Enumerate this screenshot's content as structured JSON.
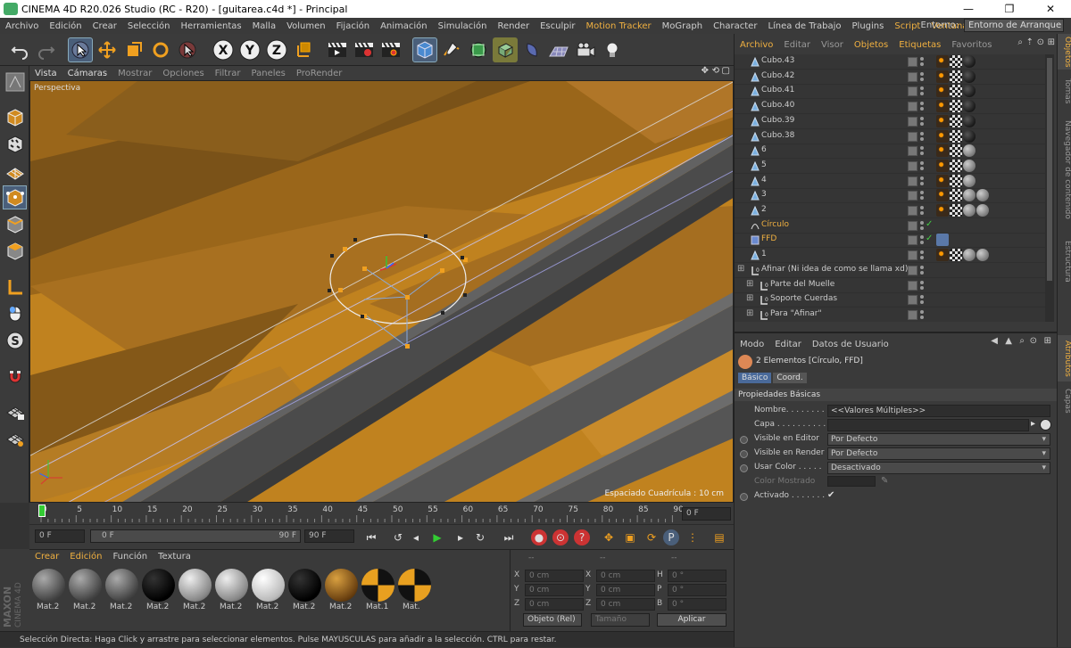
{
  "titlebar": {
    "title": "CINEMA 4D R20.026 Studio (RC - R20) - [guitarea.c4d *] - Principal",
    "minimize": "—",
    "maximize": "❐",
    "close": "✕"
  },
  "menubar": {
    "items": [
      "Archivo",
      "Edición",
      "Crear",
      "Selección",
      "Herramientas",
      "Malla",
      "Volumen",
      "Fijación",
      "Animación",
      "Simulación",
      "Render",
      "Esculpir",
      "Motion Tracker",
      "MoGraph",
      "Character",
      "Línea de Trabajo",
      "Plugins",
      "Script",
      "Ventana",
      "Ayuda"
    ],
    "highlighted": [
      "Motion Tracker",
      "Script",
      "Ventana"
    ],
    "env_label": "Entorno:",
    "env_value": "Entorno de Arranque"
  },
  "viewport": {
    "menu": [
      "Vista",
      "Cámaras",
      "Mostrar",
      "Opciones",
      "Filtrar",
      "Paneles",
      "ProRender"
    ],
    "label": "Perspectiva",
    "grid_text": "Espaciado Cuadrícula : 10 cm"
  },
  "timeline": {
    "ticks": [
      "0",
      "5",
      "10",
      "15",
      "20",
      "25",
      "30",
      "35",
      "40",
      "45",
      "50",
      "55",
      "60",
      "65",
      "70",
      "75",
      "80",
      "85",
      "90"
    ],
    "frame_display": "0 F"
  },
  "transport": {
    "start": "0 F",
    "range_start": "0 F",
    "range_end": "90 F",
    "end": "90 F"
  },
  "materials": {
    "menu": [
      "Crear",
      "Edición",
      "Función",
      "Textura"
    ],
    "items": [
      {
        "name": "Mat.2",
        "kind": "grey"
      },
      {
        "name": "Mat.2",
        "kind": "grey"
      },
      {
        "name": "Mat.2",
        "kind": "grey"
      },
      {
        "name": "Mat.2",
        "kind": "black"
      },
      {
        "name": "Mat.2",
        "kind": "light"
      },
      {
        "name": "Mat.2",
        "kind": "light"
      },
      {
        "name": "Mat.2",
        "kind": "white"
      },
      {
        "name": "Mat.2",
        "kind": "black"
      },
      {
        "name": "Mat.2",
        "kind": "brown"
      },
      {
        "name": "Mat.1",
        "kind": "checker"
      },
      {
        "name": "Mat.",
        "kind": "checker"
      }
    ]
  },
  "coords": {
    "headers": [
      "--",
      "--",
      "--"
    ],
    "rows": [
      {
        "a": "X",
        "av": "0 cm",
        "b": "X",
        "bv": "0 cm",
        "c": "H",
        "cv": "0 °"
      },
      {
        "a": "Y",
        "av": "0 cm",
        "b": "Y",
        "bv": "0 cm",
        "c": "P",
        "cv": "0 °"
      },
      {
        "a": "Z",
        "av": "0 cm",
        "b": "Z",
        "bv": "0 cm",
        "c": "B",
        "cv": "0 °"
      }
    ],
    "mode": "Objeto (Rel)",
    "size": "Tamaño",
    "apply": "Aplicar"
  },
  "status": "Selección Directa: Haga Click y arrastre para seleccionar elementos. Pulse MAYUSCULAS para añadir a la selección. CTRL para restar.",
  "objmgr": {
    "menu": [
      "Archivo",
      "Editar",
      "Visor",
      "Objetos",
      "Etiquetas",
      "Favoritos"
    ],
    "highlighted": [
      "Archivo",
      "Objetos",
      "Etiquetas"
    ],
    "rows": [
      {
        "name": "Cubo.43",
        "icon": "cone",
        "sel": false,
        "tags": [
          "t1",
          "t2",
          "t3"
        ],
        "chk": false
      },
      {
        "name": "Cubo.42",
        "icon": "cone",
        "sel": false,
        "tags": [
          "t1",
          "t2",
          "t3"
        ],
        "chk": false
      },
      {
        "name": "Cubo.41",
        "icon": "cone",
        "sel": false,
        "tags": [
          "t1",
          "t2",
          "t3"
        ],
        "chk": false
      },
      {
        "name": "Cubo.40",
        "icon": "cone",
        "sel": false,
        "tags": [
          "t1",
          "t2",
          "t3"
        ],
        "chk": false
      },
      {
        "name": "Cubo.39",
        "icon": "cone",
        "sel": false,
        "tags": [
          "t1",
          "t2",
          "t3"
        ],
        "chk": false
      },
      {
        "name": "Cubo.38",
        "icon": "cone",
        "sel": false,
        "tags": [
          "t1",
          "t2",
          "t3"
        ],
        "chk": false
      },
      {
        "name": "6",
        "icon": "cone",
        "sel": false,
        "tags": [
          "t1",
          "t2",
          "t4"
        ],
        "chk": false
      },
      {
        "name": "5",
        "icon": "cone",
        "sel": false,
        "tags": [
          "t1",
          "t2",
          "t4"
        ],
        "chk": false
      },
      {
        "name": "4",
        "icon": "cone",
        "sel": false,
        "tags": [
          "t1",
          "t2",
          "t4"
        ],
        "chk": false
      },
      {
        "name": "3",
        "icon": "cone",
        "sel": false,
        "tags": [
          "t1",
          "t2",
          "t4",
          "t4"
        ],
        "chk": false
      },
      {
        "name": "2",
        "icon": "cone",
        "sel": false,
        "tags": [
          "t1",
          "t2",
          "t4",
          "t4"
        ],
        "chk": false
      },
      {
        "name": "Círculo",
        "icon": "spline",
        "sel": true,
        "tags": [],
        "chk": true
      },
      {
        "name": "FFD",
        "icon": "ffd",
        "sel": true,
        "tags": [
          "t5"
        ],
        "chk": true
      },
      {
        "name": "1",
        "icon": "cone",
        "sel": false,
        "tags": [
          "t1",
          "t2",
          "t4",
          "t4"
        ],
        "chk": false
      },
      {
        "name": "Afinar (Ni idea de como se llama xd)",
        "icon": "null",
        "sel": false,
        "tags": [],
        "chk": false
      },
      {
        "name": "Parte del Muelle",
        "icon": "null",
        "sel": false,
        "tags": [],
        "chk": false
      },
      {
        "name": "Soporte Cuerdas",
        "icon": "null",
        "sel": false,
        "tags": [],
        "chk": false
      },
      {
        "name": "Para \"Afinar\"",
        "icon": "null",
        "sel": false,
        "tags": [],
        "chk": false
      }
    ]
  },
  "attrmgr": {
    "menu": [
      "Modo",
      "Editar",
      "Datos de Usuario"
    ],
    "header": "2 Elementos [Círculo, FFD]",
    "tabs": [
      "Básico",
      "Coord."
    ],
    "section": "Propiedades Básicas",
    "props": [
      {
        "label": "Nombre. . . . . . . . .",
        "value": "<<Valores Múltiples>>",
        "type": "text",
        "radio": false,
        "dim": false
      },
      {
        "label": "Capa . . . . . . . . . .",
        "value": "",
        "type": "text",
        "radio": false,
        "dim": false
      },
      {
        "label": "Visible en Editor",
        "value": "Por Defecto",
        "type": "dd",
        "radio": true,
        "dim": false
      },
      {
        "label": "Visible en Render",
        "value": "Por Defecto",
        "type": "dd",
        "radio": true,
        "dim": false
      },
      {
        "label": "Usar Color . . . . .",
        "value": "Desactivado",
        "type": "dd",
        "radio": true,
        "dim": false
      },
      {
        "label": "Color Mostrado",
        "value": "",
        "type": "color",
        "radio": false,
        "dim": true
      },
      {
        "label": "Activado . . . . . . .",
        "value": "✔",
        "type": "check",
        "radio": true,
        "dim": false
      }
    ]
  },
  "rightstrip": {
    "tabs": [
      "Objetos",
      "Tomas",
      "Navegador de contenido",
      "Estructura",
      "Atributos",
      "Capas"
    ]
  },
  "maxon": {
    "line1": "MAXON",
    "line2": "CINEMA 4D"
  }
}
